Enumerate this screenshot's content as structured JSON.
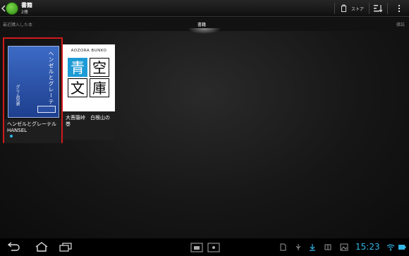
{
  "app": {
    "title": "書籍",
    "subtitle": "2冊",
    "store_label": "ストア"
  },
  "tabs": [
    {
      "label": "最近購入した本"
    },
    {
      "label": "書籍"
    },
    {
      "label": "雑誌"
    }
  ],
  "books": [
    {
      "title": "ヘンゼルとグレーテル HANSEL",
      "cover_title": "ヘンゼルとグレーテル",
      "cover_author": "グリム兄弟",
      "is_new": true,
      "selected": true
    },
    {
      "title": "大菩薩峠　白根山の巻",
      "cover_brand": "AOZORA BUNKO",
      "cover_kanji": [
        "青",
        "空",
        "文",
        "庫"
      ]
    }
  ],
  "status_bar": {
    "time": "15:23"
  },
  "icons": {
    "back": "back-arrow-icon",
    "home": "home-icon",
    "recents": "recent-apps-icon",
    "store": "store-bag-icon",
    "sort": "sort-icon",
    "overflow": "overflow-menu-icon"
  },
  "colors": {
    "accent": "#33b5e5",
    "selection": "#d11a1a"
  }
}
